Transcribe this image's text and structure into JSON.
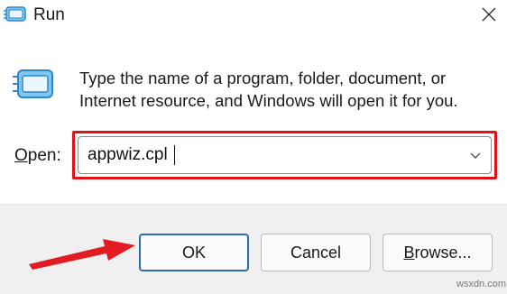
{
  "window": {
    "title": "Run",
    "description": "Type the name of a program, folder, document, or Internet resource, and Windows will open it for you."
  },
  "open_field": {
    "label_prefix": "O",
    "label_rest": "pen:",
    "value": "appwiz.cpl"
  },
  "buttons": {
    "ok": "OK",
    "cancel": "Cancel",
    "browse_prefix": "B",
    "browse_rest": "rowse..."
  },
  "colors": {
    "highlight": "#d9141b",
    "arrow": "#e31b23",
    "accent": "#2b6db0"
  },
  "icons": {
    "title": "run-icon",
    "large": "run-icon",
    "close": "close-icon",
    "dropdown": "chevron-down-icon",
    "annotation": "arrow-right-icon"
  },
  "watermark": "wsxdn.com"
}
